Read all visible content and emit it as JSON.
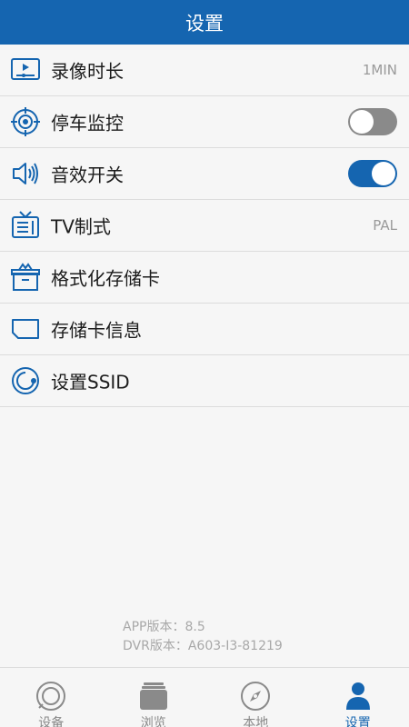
{
  "header": {
    "title": "设置"
  },
  "settings": {
    "items": [
      {
        "label": "录像时长",
        "value": "1MIN",
        "icon": "video-duration-icon"
      },
      {
        "label": "停车监控",
        "toggle": "off",
        "icon": "target-icon"
      },
      {
        "label": "音效开关",
        "toggle": "on",
        "icon": "speaker-icon"
      },
      {
        "label": "TV制式",
        "value": "PAL",
        "icon": "tv-icon"
      },
      {
        "label": "格式化存储卡",
        "icon": "format-box-icon"
      },
      {
        "label": "存储卡信息",
        "icon": "sd-card-icon"
      },
      {
        "label": "设置SSID",
        "icon": "ssid-circle-icon"
      }
    ]
  },
  "version": {
    "app": "APP版本：8.5",
    "dvr": "DVR版本：A603-I3-81219"
  },
  "tabbar": {
    "tabs": [
      {
        "label": "设备",
        "icon": "camera-lens-icon"
      },
      {
        "label": "浏览",
        "icon": "album-icon"
      },
      {
        "label": "本地",
        "icon": "compass-icon"
      },
      {
        "label": "设置",
        "icon": "user-icon",
        "active": true
      }
    ]
  },
  "colors": {
    "accent": "#1565b0",
    "toggle_off": "#8a8a8a",
    "muted_text": "#9a9a9a"
  }
}
